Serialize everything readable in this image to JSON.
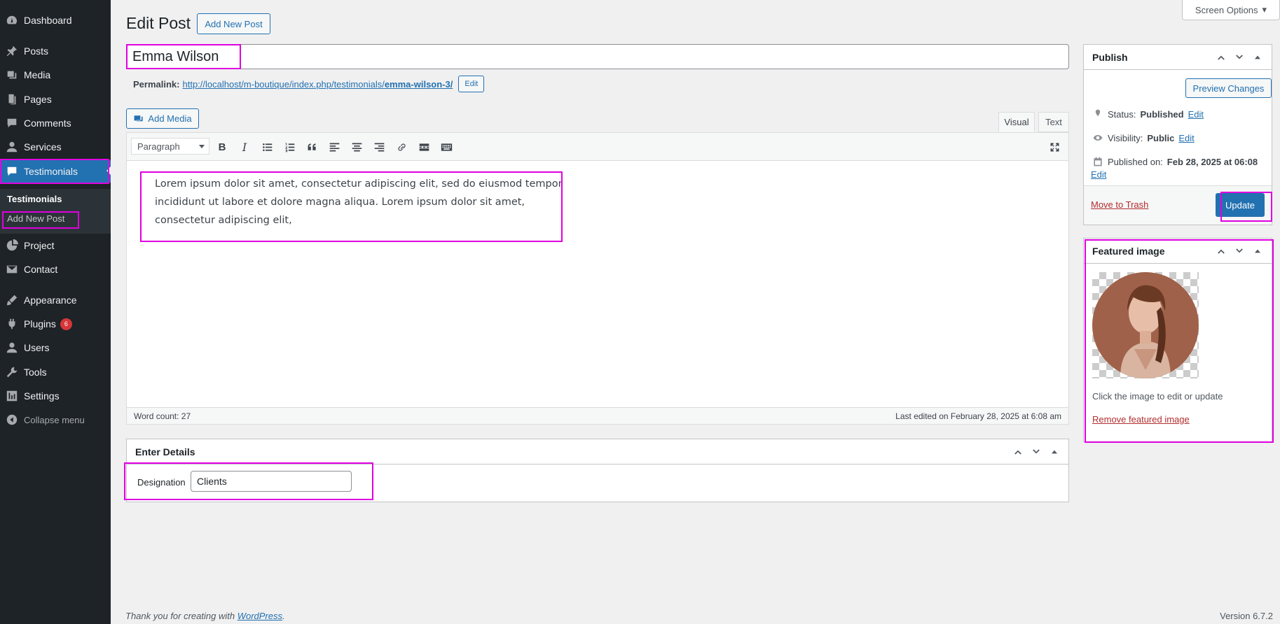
{
  "sidebar": {
    "items": [
      {
        "label": "Dashboard",
        "icon": "dashboard-icon"
      },
      {
        "label": "Posts",
        "icon": "pin-icon"
      },
      {
        "label": "Media",
        "icon": "media-icon"
      },
      {
        "label": "Pages",
        "icon": "pages-icon"
      },
      {
        "label": "Comments",
        "icon": "comment-icon"
      },
      {
        "label": "Services",
        "icon": "user-icon"
      },
      {
        "label": "Testimonials",
        "icon": "testimonial-icon"
      },
      {
        "label": "Project",
        "icon": "pie-icon"
      },
      {
        "label": "Contact",
        "icon": "mail-icon"
      },
      {
        "label": "Appearance",
        "icon": "brush-icon"
      },
      {
        "label": "Plugins",
        "icon": "plugin-icon",
        "badge": "6"
      },
      {
        "label": "Users",
        "icon": "user-icon"
      },
      {
        "label": "Tools",
        "icon": "wrench-icon"
      },
      {
        "label": "Settings",
        "icon": "settings-icon"
      },
      {
        "label": "Collapse menu",
        "icon": "collapse-icon"
      }
    ],
    "submenu": {
      "current": "Testimonials",
      "add_new": "Add New Post"
    }
  },
  "header": {
    "title": "Edit Post",
    "add_new_label": "Add New Post",
    "screen_options": "Screen Options"
  },
  "post": {
    "title": "Emma Wilson",
    "permalink_label": "Permalink:",
    "permalink_base": "http://localhost/m-boutique/index.php/testimonials/",
    "permalink_slug": "emma-wilson-3/",
    "permalink_edit": "Edit"
  },
  "editor": {
    "add_media": "Add Media",
    "tab_visual": "Visual",
    "tab_text": "Text",
    "format": "Paragraph",
    "content": "Lorem ipsum dolor sit amet, consectetur adipiscing elit, sed do eiusmod tempor incididunt ut labore et dolore magna aliqua. Lorem ipsum dolor sit amet, consectetur adipiscing elit,",
    "word_count": "Word count: 27",
    "last_edited": "Last edited on February 28, 2025 at 6:08 am"
  },
  "details": {
    "title": "Enter Details",
    "designation_label": "Designation",
    "designation_value": "Clients"
  },
  "publish": {
    "title": "Publish",
    "preview": "Preview Changes",
    "status_label": "Status:",
    "status_value": "Published",
    "visibility_label": "Visibility:",
    "visibility_value": "Public",
    "published_label": "Published on:",
    "published_value": "Feb 28, 2025 at 06:08",
    "edit": "Edit",
    "trash": "Move to Trash",
    "update": "Update"
  },
  "featured": {
    "title": "Featured image",
    "hint": "Click the image to edit or update",
    "remove": "Remove featured image"
  },
  "footer": {
    "thanks_prefix": "Thank you for creating with",
    "thanks_link": "WordPress",
    "version": "Version 6.7.2"
  },
  "colors": {
    "sidebar_bg": "#1d2327",
    "accent": "#2271b1",
    "highlight": "#e000e0",
    "danger": "#b32d2e"
  }
}
